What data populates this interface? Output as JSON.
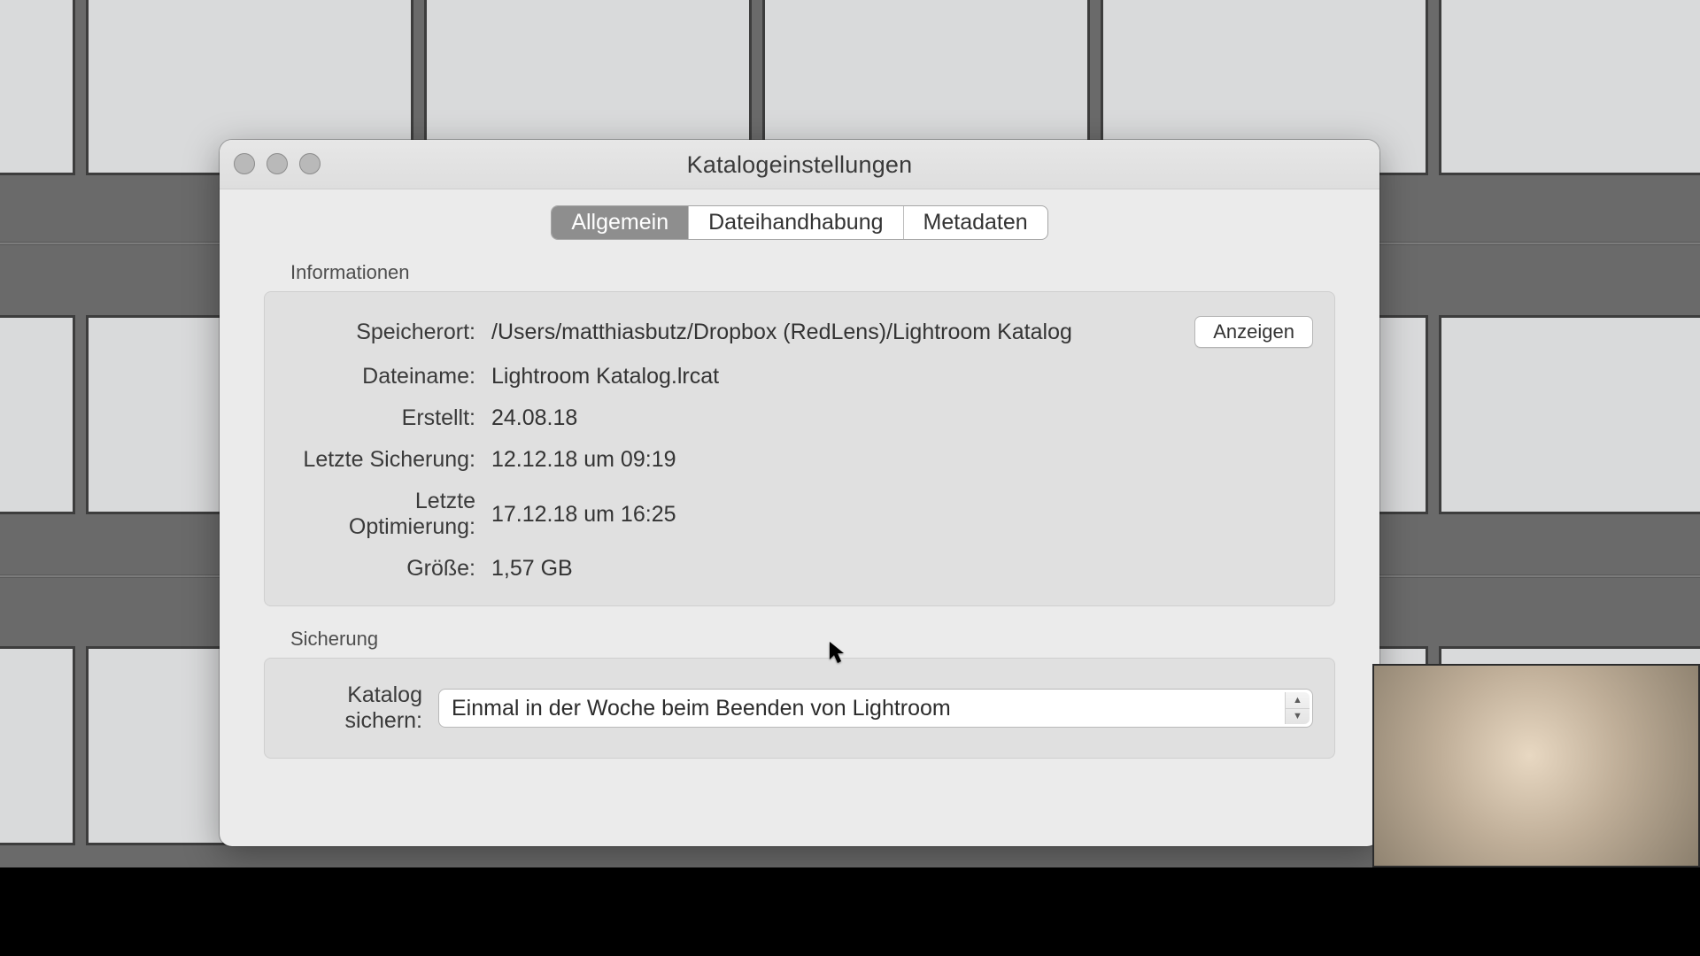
{
  "dialog": {
    "title": "Katalogeinstellungen",
    "tabs": [
      "Allgemein",
      "Dateihandhabung",
      "Metadaten"
    ],
    "active_tab": 0,
    "sections": {
      "info": {
        "heading": "Informationen",
        "show_button": "Anzeigen",
        "rows": {
          "location": {
            "label": "Speicherort:",
            "value": "/Users/matthiasbutz/Dropbox (RedLens)/Lightroom Katalog"
          },
          "filename": {
            "label": "Dateiname:",
            "value": "Lightroom Katalog.lrcat"
          },
          "created": {
            "label": "Erstellt:",
            "value": "24.08.18"
          },
          "lastbackup": {
            "label": "Letzte Sicherung:",
            "value": "12.12.18 um 09:19"
          },
          "lastopt": {
            "label": "Letzte Optimierung:",
            "value": "17.12.18 um 16:25"
          },
          "size": {
            "label": "Größe:",
            "value": "1,57 GB"
          }
        }
      },
      "backup": {
        "heading": "Sicherung",
        "label": "Katalog sichern:",
        "selected": "Einmal in der Woche beim Beenden von Lightroom"
      }
    }
  }
}
